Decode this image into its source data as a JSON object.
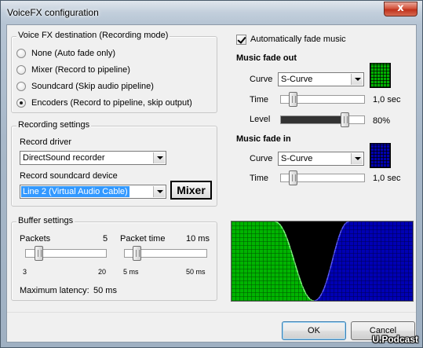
{
  "window": {
    "title": "VoiceFX configuration",
    "close_glyph": "x"
  },
  "destination": {
    "title": "Voice FX destination (Recording mode)",
    "options": [
      {
        "label": "None (Auto fade only)",
        "checked": false
      },
      {
        "label": "Mixer (Record to pipeline)",
        "checked": false
      },
      {
        "label": "Soundcard (Skip audio pipeline)",
        "checked": false
      },
      {
        "label": "Encoders (Record to pipeline, skip output)",
        "checked": true
      }
    ]
  },
  "recording": {
    "title": "Recording settings",
    "driver_label": "Record driver",
    "driver_value": "DirectSound recorder",
    "device_label": "Record soundcard device",
    "device_value": "Line 2 (Virtual Audio Cable)",
    "mixer_button": "Mixer"
  },
  "buffer": {
    "title": "Buffer settings",
    "packets_label": "Packets",
    "packets_value": "5",
    "packets_min": "3",
    "packets_max": "20",
    "packets_position": 0.12,
    "packet_time_label": "Packet time",
    "packet_time_value": "10 ms",
    "packet_time_min": "5 ms",
    "packet_time_max": "50 ms",
    "packet_time_position": 0.11,
    "latency_label": "Maximum latency:",
    "latency_value": "50 ms"
  },
  "music": {
    "auto_fade_label": "Automatically fade music",
    "auto_fade_checked": true,
    "fade_out": {
      "heading": "Music fade out",
      "curve_label": "Curve",
      "curve_value": "S-Curve",
      "time_label": "Time",
      "time_value": "1,0 sec",
      "time_position": 0.1,
      "level_label": "Level",
      "level_value": "80%",
      "level_position": 0.8,
      "swatch_color": "#00b000"
    },
    "fade_in": {
      "heading": "Music fade in",
      "curve_label": "Curve",
      "curve_value": "S-Curve",
      "time_label": "Time",
      "time_value": "1,0 sec",
      "time_position": 0.1,
      "swatch_color": "#0000b0"
    }
  },
  "buttons": {
    "ok": "OK",
    "cancel": "Cancel"
  },
  "watermark": "U.Podcast"
}
